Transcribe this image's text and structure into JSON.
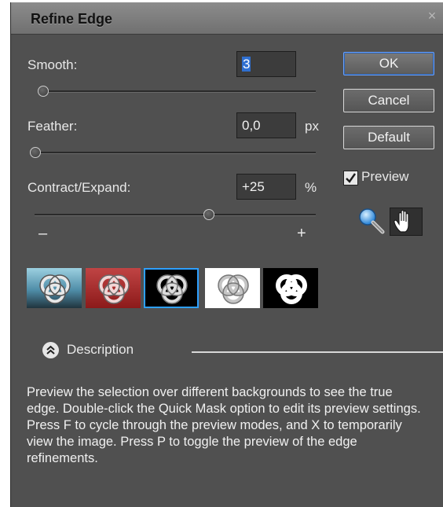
{
  "window": {
    "title": "Refine Edge",
    "close_glyph": "×"
  },
  "smooth": {
    "label": "Smooth:",
    "value": "3",
    "level": 0.0
  },
  "feather": {
    "label": "Feather:",
    "value": "0,0",
    "unit": "px",
    "level": 0.0
  },
  "contract": {
    "label": "Contract/Expand:",
    "value": "+25",
    "unit": "%",
    "level": 0.625,
    "minus": "–",
    "plus": "+"
  },
  "buttons": {
    "ok": "OK",
    "cancel": "Cancel",
    "default": "Default"
  },
  "preview": {
    "label": "Preview",
    "checked": true
  },
  "tools": [
    "zoom-icon",
    "hand-icon"
  ],
  "view_modes": [
    {
      "name": "view-standard",
      "bg": "#7fb3c6"
    },
    {
      "name": "view-quick-mask",
      "bg": "#a02020"
    },
    {
      "name": "view-on-black",
      "bg": "#000000",
      "selected": true
    },
    {
      "name": "view-on-white",
      "bg": "#ffffff"
    },
    {
      "name": "view-mask",
      "bg": "#000000"
    }
  ],
  "description": {
    "label": "Description",
    "text": "Preview the selection over different backgrounds to see the true edge. Double-click the Quick Mask option to edit its preview settings. Press F to cycle through the preview modes, and X to temporarily view the image. Press P to toggle the preview of the edge refinements."
  },
  "colors": {
    "dialog_bg": "#505050",
    "accent": "#2ea0ff",
    "quick_mask": "#a02020"
  }
}
